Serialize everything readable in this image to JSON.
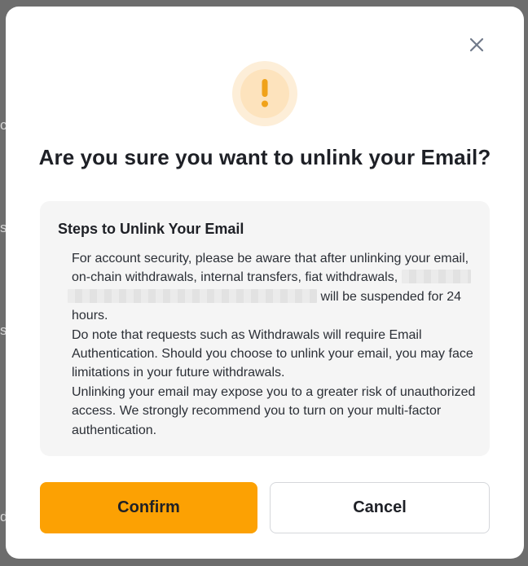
{
  "backdrop": {
    "fragments": [
      "c",
      "s",
      "s",
      "d"
    ]
  },
  "modal": {
    "title": "Are you sure you want to unlink your Email?",
    "alert_icon": "exclamation-icon",
    "close_icon": "close-icon",
    "accent_color": "#FCA103",
    "steps": {
      "heading": "Steps to Unlink Your Email",
      "para1_line1": "For account security, please be aware that after unlinking your email,",
      "para1_line2": "on-chain withdrawals, internal transfers, fiat withdrawals,",
      "para1_line3_suffix": "will be suspended for 24",
      "para1_line4": "hours.",
      "para2": "Do note that requests such as Withdrawals will require Email Authentication. Should you choose to unlink your email, you may face limitations in your future withdrawals.",
      "para3": "Unlinking your email may expose you to a greater risk of unauthorized access. We strongly recommend you to turn on your multi-factor authentication."
    },
    "buttons": {
      "confirm_label": "Confirm",
      "cancel_label": "Cancel"
    }
  }
}
